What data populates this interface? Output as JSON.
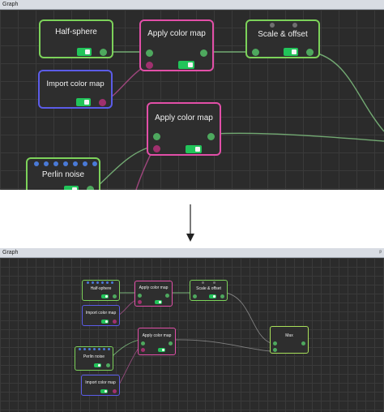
{
  "top_panel": {
    "title": "Graph",
    "nodes": {
      "half_sphere": "Half-sphere",
      "apply_color_map_1": "Apply color map",
      "scale_offset": "Scale & offset",
      "import_color_map": "Import color map",
      "apply_color_map_2": "Apply color map",
      "perlin_noise": "Perlin noise"
    }
  },
  "bottom_panel": {
    "title": "Graph",
    "pin_glyph": "ᵖ",
    "nodes": {
      "half_sphere": "Half-sphere",
      "apply_color_map_1": "Apply color map",
      "scale_offset": "Scale & offset",
      "import_color_map_1": "Import color map",
      "apply_color_map_2": "Apply color map",
      "perlin_noise": "Perlin noise",
      "import_color_map_2": "Import color map",
      "max": "Max"
    }
  },
  "colors": {
    "canvas_bg": "#2b2b2b",
    "green_border": "#7cd25a",
    "pink_border": "#e24fa8",
    "blue_border": "#5b5ce8",
    "toggle_on": "#22c45a"
  },
  "icons": [
    "down-arrow-icon",
    "pin-icon"
  ]
}
